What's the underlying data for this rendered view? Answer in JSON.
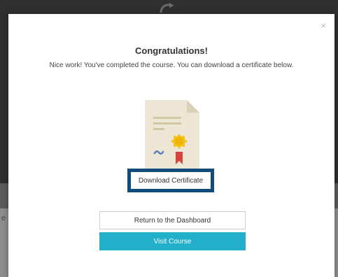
{
  "background": {
    "partial_text": "e",
    "colors": {
      "top": "#2f2f2f",
      "band": "#5b5b5b",
      "bottom": "#8d8d8d"
    }
  },
  "modal": {
    "close_label": "×",
    "title": "Congratulations!",
    "message": "Nice work! You've completed the course. You can download a certificate below.",
    "certificate_icon": "certificate-icon",
    "download_label": "Download Certificate",
    "dashboard_label": "Return to the Dashboard",
    "visit_label": "Visit Course",
    "colors": {
      "accent": "#21afc9",
      "focus_border": "#0f4c7c",
      "paper": "#ede6d4",
      "seal": "#f5c21b",
      "ribbon": "#d9433a"
    }
  }
}
